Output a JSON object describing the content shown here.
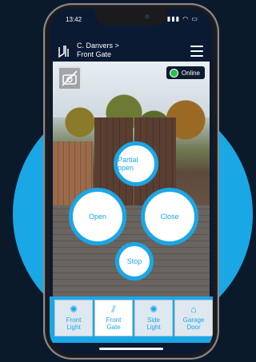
{
  "status": {
    "time": "13:42",
    "icons": "▮▮▮ ◠ ▭"
  },
  "header": {
    "breadcrumb_top": "C. Danvers >",
    "breadcrumb_bottom": "Front Gate"
  },
  "camera": {
    "status": "Online"
  },
  "controls": {
    "partial_open": "Partial open",
    "open": "Open",
    "close": "Close",
    "stop": "Stop"
  },
  "nav": {
    "tabs": [
      {
        "line1": "Front",
        "line2": "Light",
        "icon": "bulb-icon"
      },
      {
        "line1": "Front",
        "line2": "Gate",
        "icon": "gate-icon"
      },
      {
        "line1": "Side",
        "line2": "Light",
        "icon": "bulb-icon"
      },
      {
        "line1": "Garage",
        "line2": "Door",
        "icon": "garage-icon"
      }
    ]
  },
  "colors": {
    "accent": "#1aa7e6",
    "online": "#27c24c",
    "header_bg": "#0a1a33"
  }
}
